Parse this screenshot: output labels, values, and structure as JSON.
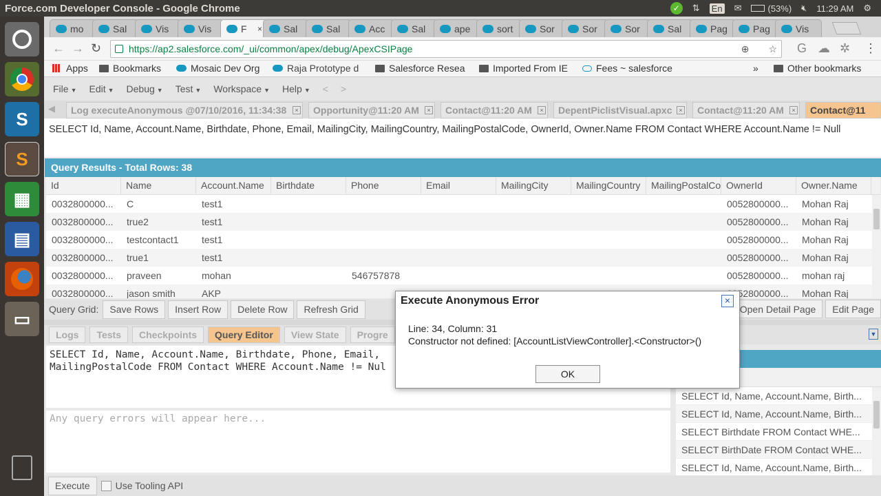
{
  "os": {
    "title": "Force.com Developer Console - Google Chrome",
    "lang": "En",
    "battery": "(53%)",
    "time": "11:29 AM"
  },
  "browser_tabs": [
    "mo",
    "Sal",
    "Vis",
    "Vis",
    "F",
    "Sal",
    "Sal",
    "Acc",
    "Sal",
    "ape",
    "sort",
    "Sor",
    "Sor",
    "Sor",
    "Sal",
    "Pag",
    "Pag",
    "Vis"
  ],
  "address": {
    "url": "https://ap2.salesforce.com/_ui/common/apex/debug/ApexCSIPage"
  },
  "bookmarks": {
    "apps": "Apps",
    "items": [
      "Bookmarks",
      "Mosaic Dev Org",
      "Raja Prototype d",
      "Salesforce Resea",
      "Imported From IE",
      "Fees ~ salesforce"
    ],
    "more": "»",
    "other": "Other bookmarks"
  },
  "menu": {
    "items": [
      "File",
      "Edit",
      "Debug",
      "Test",
      "Workspace",
      "Help"
    ],
    "back": "<",
    "forward": ">"
  },
  "workspace_tabs": [
    "Log executeAnonymous @07/10/2016, 11:34:38",
    "Opportunity@11:20 AM",
    "Contact@11:20 AM",
    "DepentPiclistVisual.apxc",
    "Contact@11:20 AM",
    "Contact@11"
  ],
  "query_text": "SELECT Id, Name, Account.Name, Birthdate, Phone, Email, MailingCity, MailingCountry, MailingPostalCode, OwnerId, Owner.Name FROM Contact WHERE Account.Name != Null",
  "results": {
    "header": "Query Results - Total Rows: 38",
    "columns": [
      "Id",
      "Name",
      "Account.Name",
      "Birthdate",
      "Phone",
      "Email",
      "MailingCity",
      "MailingCountry",
      "MailingPostalCo",
      "OwnerId",
      "Owner.Name"
    ],
    "rows": [
      [
        "0032800000...",
        "C",
        "test1",
        "",
        "",
        "",
        "",
        "",
        "",
        "0052800000...",
        "Mohan Raj"
      ],
      [
        "0032800000...",
        "true2",
        "test1",
        "",
        "",
        "",
        "",
        "",
        "",
        "0052800000...",
        "Mohan Raj"
      ],
      [
        "0032800000...",
        "testcontact1",
        "test1",
        "",
        "",
        "",
        "",
        "",
        "",
        "0052800000...",
        "Mohan Raj"
      ],
      [
        "0032800000...",
        "true1",
        "test1",
        "",
        "",
        "",
        "",
        "",
        "",
        "0052800000...",
        "Mohan Raj"
      ],
      [
        "0032800000...",
        "praveen",
        "mohan",
        "",
        "546757878",
        "",
        "",
        "",
        "",
        "0052800000...",
        "mohan raj"
      ],
      [
        "0032800000...",
        "jason smith",
        "AKP",
        "",
        "",
        "",
        "",
        "",
        "",
        "0052800000...",
        "Mohan Raj"
      ]
    ]
  },
  "grid_bar": {
    "label": "Query Grid:",
    "save": "Save Rows",
    "insert": "Insert Row",
    "delete": "Delete Row",
    "refresh": "Refresh Grid",
    "open_detail": "Open Detail Page",
    "edit_page": "Edit Page"
  },
  "bottom_tabs": [
    "Logs",
    "Tests",
    "Checkpoints",
    "Query Editor",
    "View State",
    "Progre"
  ],
  "editor": {
    "line1": "SELECT Id, Name, Account.Name, Birthdate, Phone, Email,",
    "line2": "MailingPostalCode FROM Contact WHERE Account.Name != Nul",
    "errors_placeholder": "Any query errors will appear here..."
  },
  "history": [
    "SELECT Id, Name, Account.Name, Birth...",
    "SELECT Id, Name, Account.Name, Birth...",
    "SELECT Birthdate FROM Contact WHE...",
    "SELECT BirthDate FROM Contact WHE...",
    "SELECT Id, Name, Account.Name, Birth..."
  ],
  "exec_bar": {
    "execute": "Execute",
    "tooling": "Use Tooling API"
  },
  "modal": {
    "title": "Execute Anonymous Error",
    "line1": "Line: 34, Column: 31",
    "line2": "Constructor not defined: [AccountListViewController].<Constructor>()",
    "ok": "OK",
    "close": "×"
  }
}
